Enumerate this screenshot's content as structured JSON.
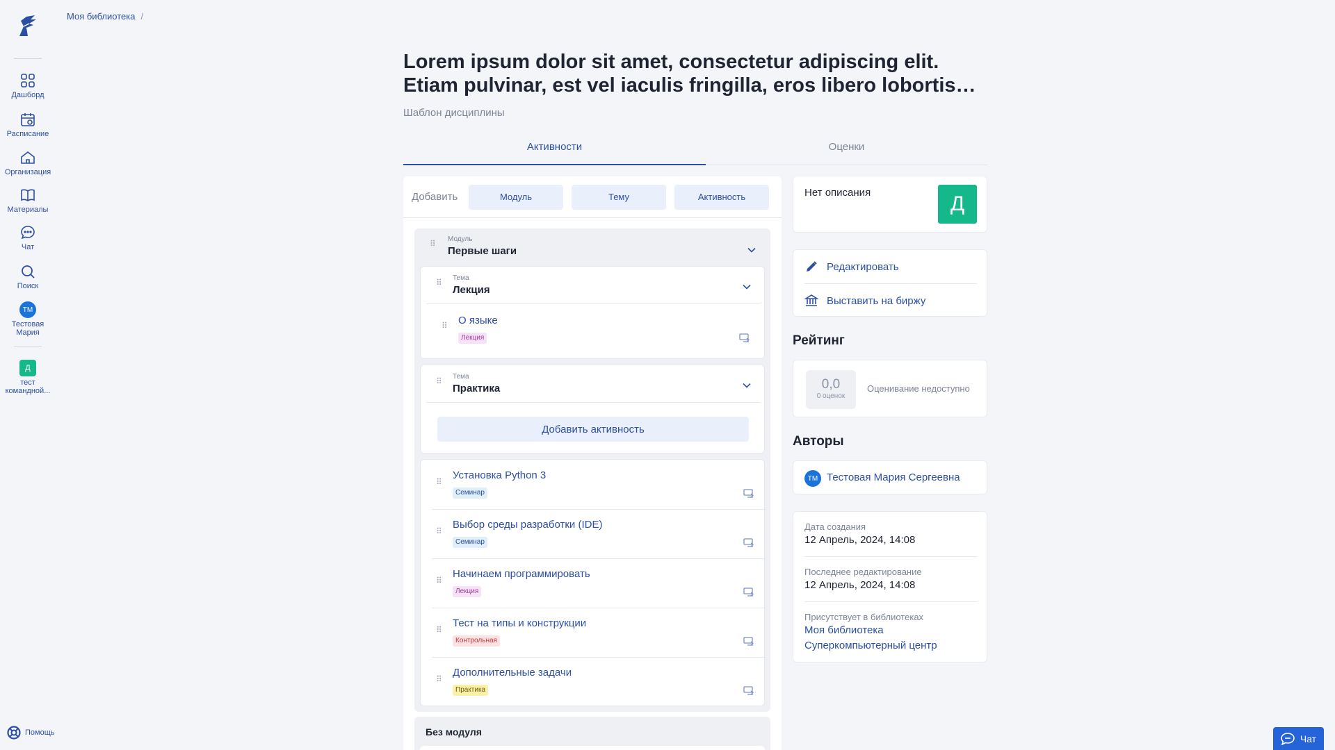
{
  "breadcrumb": {
    "item": "Моя библиотека",
    "separator": "/"
  },
  "sidebar": {
    "items": [
      {
        "label": "Дашборд",
        "icon": "dashboard-icon"
      },
      {
        "label": "Расписание",
        "icon": "calendar-icon"
      },
      {
        "label": "Организация",
        "icon": "home-icon"
      },
      {
        "label": "Материалы",
        "icon": "book-icon"
      },
      {
        "label": "Чат",
        "icon": "chat-icon"
      },
      {
        "label": "Поиск",
        "icon": "search-icon"
      }
    ],
    "user": {
      "initials": "ТМ",
      "label": "Тестовая Мария"
    },
    "team": {
      "initial": "Д",
      "label": "тест командной..."
    },
    "help": "Помощь"
  },
  "page": {
    "title": "Lorem ipsum dolor sit amet, consectetur adipiscing elit. Etiam pulvinar, est vel iaculis fringilla, eros libero lobortis…",
    "subtitle": "Шаблон дисциплины"
  },
  "tabs": {
    "activities": "Активности",
    "grades": "Оценки"
  },
  "addbar": {
    "label": "Добавить",
    "module": "Модуль",
    "topic": "Тему",
    "activity": "Активность"
  },
  "module": {
    "caption": "Модуль",
    "name": "Первые шаги",
    "topics": [
      {
        "caption": "Тема",
        "name": "Лекция",
        "items": [
          {
            "title": "О языке",
            "badge": "Лекция"
          }
        ]
      },
      {
        "caption": "Тема",
        "name": "Практика",
        "add_label": "Добавить активность"
      }
    ],
    "items": [
      {
        "title": "Установка Python 3",
        "badge": "Семинар"
      },
      {
        "title": "Выбор среды разработки (IDE)",
        "badge": "Семинар"
      },
      {
        "title": "Начинаем программировать",
        "badge": "Лекция"
      },
      {
        "title": "Тест на типы и конструкции",
        "badge": "Контрольная"
      },
      {
        "title": "Дополнительные задачи",
        "badge": "Практика"
      }
    ]
  },
  "no_module": "Без модуля",
  "description": {
    "text": "Нет описания",
    "letter": "Д"
  },
  "actions": {
    "edit": "Редактировать",
    "publish": "Выставить на биржу"
  },
  "rating": {
    "heading": "Рейтинг",
    "value": "0,0",
    "count": "0 оценок",
    "status": "Оценивание недоступно"
  },
  "authors": {
    "heading": "Авторы",
    "initials": "ТМ",
    "name": "Тестовая Мария Сергеевна"
  },
  "meta": {
    "created_label": "Дата создания",
    "created": "12 Апрель, 2024, 14:08",
    "edited_label": "Последнее редактирование",
    "edited": "12 Апрель, 2024, 14:08",
    "libraries_label": "Присутствует в библиотеках",
    "libraries": [
      "Моя библиотека",
      "Суперкомпьютерный центр"
    ]
  },
  "chat_widget": "Чат",
  "colors": {
    "accent": "#2c4ea3",
    "teal": "#14b88a",
    "chat": "#2563d9"
  }
}
